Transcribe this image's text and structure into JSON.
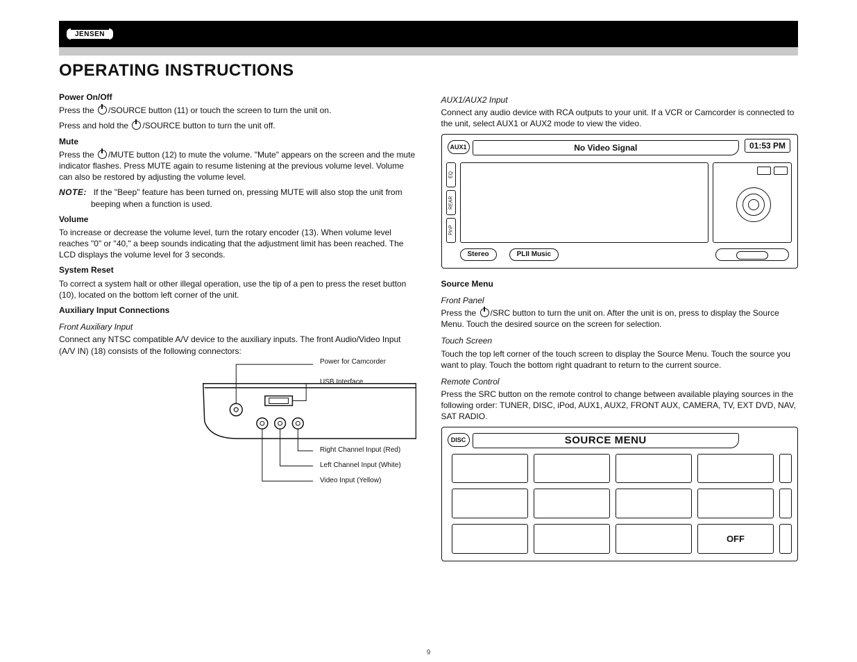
{
  "brand": "JENSEN",
  "page_title": "OPERATING INSTRUCTIONS",
  "page_number": "9",
  "left": {
    "s1": {
      "title": "Power On/Off"
    },
    "p1a": "Press the ",
    "p1b": "/SOURCE button (11) or touch the screen to turn the unit on.",
    "p1c": "Press and hold the ",
    "p1d": "/SOURCE button to turn the unit off.",
    "s2": {
      "title": "Mute"
    },
    "p2a": "Press the ",
    "p2b": "/MUTE button (12) to mute the volume. \"Mute\" appears on the screen and the mute indicator flashes. Press MUTE again to resume listening at the previous volume level. Volume can also be restored by adjusting the volume level.",
    "note_label": "NOTE:",
    "note_body": "If the \"Beep\" feature has been turned on, pressing MUTE will also stop the unit from beeping when a function is used.",
    "s3": {
      "title": "Volume"
    },
    "p3": "To increase or decrease the volume level, turn the rotary encoder (13). When volume level reaches \"0\" or \"40,\" a beep sounds indicating that the adjustment limit has been reached. The LCD displays the volume level for 3 seconds.",
    "s4": {
      "title": "System Reset"
    },
    "p4": "To correct a system halt or other illegal operation, use the tip of a pen to press the reset button (10), located on the bottom left corner of the unit.",
    "s5": {
      "title": "Auxiliary Input Connections"
    },
    "sub5a": "Front Auxiliary Input",
    "p5a": "Connect any NTSC compatible A/V device to the auxiliary inputs. The front Audio/Video Input (A/V IN) (18) consists of the following connectors:",
    "diagram": {
      "labels": {
        "power": "Power for Camcorder",
        "usb": "USB Interface",
        "right": "Right Channel Input (Red)",
        "left": "Left Channel Input (White)",
        "video": "Video Input (Yellow)"
      }
    }
  },
  "right": {
    "sub1": "AUX1/AUX2 Input",
    "p1": "Connect any audio device with RCA outputs to your unit. If a VCR or Camcorder is connected to the unit, select AUX1 or AUX2 mode to view the video.",
    "lcd": {
      "badge": "AUX1",
      "title": "No Video Signal",
      "clock": "01:53 PM",
      "side": [
        "EQ",
        "REAR",
        "PinP"
      ],
      "foot_stereo": "Stereo",
      "foot_plii": "PLII Music"
    },
    "s2": {
      "title": "Source Menu"
    },
    "sub2": "Front Panel",
    "p2a": "Press the ",
    "p2b": "/SRC button to turn the unit on. After the unit is on, press to display the Source Menu. Touch the desired source on the screen for selection.",
    "sub3": "Touch Screen",
    "p3": "Touch the top left corner of the touch screen to display the Source Menu. Touch the source you want to play. Touch the bottom right quadrant to return to the current source.",
    "sub4": "Remote Control",
    "p4": "Press the SRC button on the remote control to change between available playing sources in the following order: TUNER, DISC, iPod, AUX1, AUX2, FRONT AUX, CAMERA, TV, EXT DVD, NAV, SAT RADIO.",
    "src": {
      "badge": "DISC",
      "title": "SOURCE MENU",
      "off": "OFF"
    }
  }
}
